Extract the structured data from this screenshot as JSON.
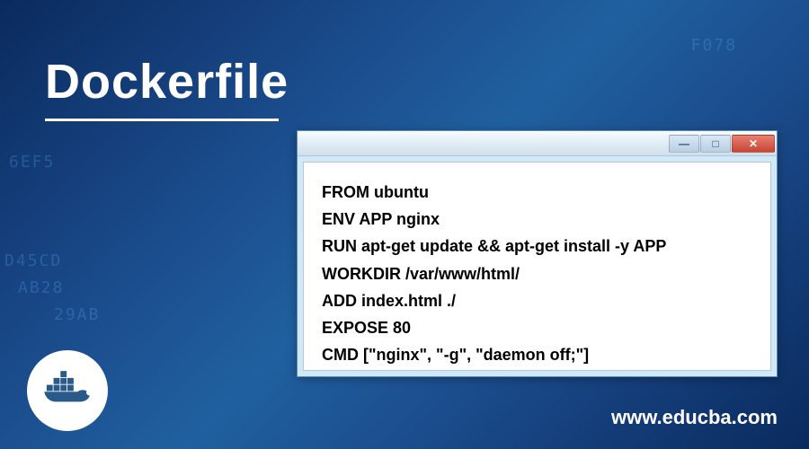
{
  "title": "Dockerfile",
  "code": {
    "line1": "FROM ubuntu",
    "line2": "ENV APP nginx",
    "line3": "RUN apt-get update && apt-get install -y APP",
    "line4": "WORKDIR /var/www/html/",
    "line5": "ADD index.html ./",
    "line6": "EXPOSE 80",
    "line7": "CMD [\"nginx\", \"-g\", \"daemon off;\"]"
  },
  "window_buttons": {
    "minimize": "—",
    "maximize": "□",
    "close": "✕"
  },
  "website": "www.educba.com",
  "bg_hex": {
    "h1": "F078",
    "h2": "6EF5",
    "h3": "D45CD",
    "h4": "AB28",
    "h5": "29AB"
  }
}
